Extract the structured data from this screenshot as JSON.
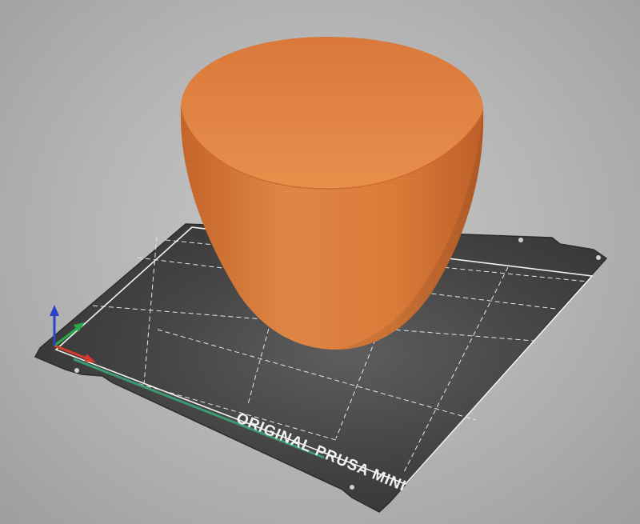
{
  "scene": {
    "bed": {
      "label": "ORIGINAL PRUSA MINI"
    },
    "model": {
      "type": "bowl",
      "color": "#e0813f"
    },
    "axes": {
      "x_color": "#d63a2a",
      "y_color": "#2ca84a",
      "z_color": "#2b43c6"
    }
  }
}
